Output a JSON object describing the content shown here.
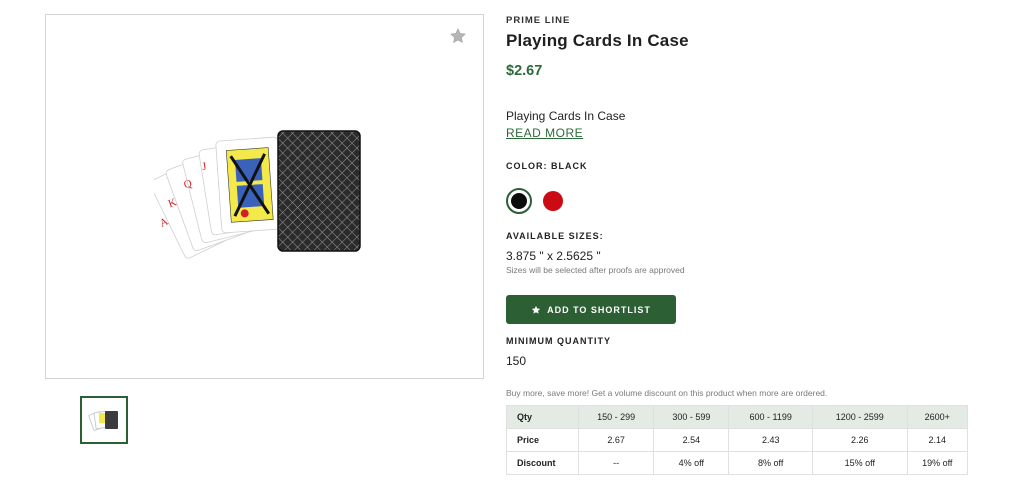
{
  "product": {
    "brand": "PRIME LINE",
    "title": "Playing Cards In Case",
    "price": "$2.67",
    "description": "Playing Cards In Case",
    "read_more": "READ MORE"
  },
  "colors": {
    "label": "COLOR: BLACK",
    "swatches": [
      {
        "name": "black",
        "hex": "#0b0b0b",
        "selected": true
      },
      {
        "name": "red",
        "hex": "#cc0a14",
        "selected": false
      }
    ]
  },
  "sizes": {
    "label": "AVAILABLE SIZES:",
    "value": "3.875 \" x 2.5625 \"",
    "note": "Sizes will be selected after proofs are approved"
  },
  "actions": {
    "shortlist_label": "ADD TO SHORTLIST",
    "shortlist_icon": "star-icon"
  },
  "minimum": {
    "label": "MINIMUM QUANTITY",
    "value": "150"
  },
  "pricing": {
    "note": "Buy more, save more! Get a volume discount on this product when more are ordered.",
    "header_label": "Qty",
    "headers": [
      "150 - 299",
      "300 - 599",
      "600 - 1199",
      "1200 - 2599",
      "2600+"
    ],
    "price_label": "Price",
    "prices": [
      "2.67",
      "2.54",
      "2.43",
      "2.26",
      "2.14"
    ],
    "discount_label": "Discount",
    "discounts": [
      "--",
      "4% off",
      "8% off",
      "15% off",
      "19% off"
    ]
  },
  "theme": {
    "accent": "#2d5f34",
    "price_color": "#2d6a3a"
  }
}
